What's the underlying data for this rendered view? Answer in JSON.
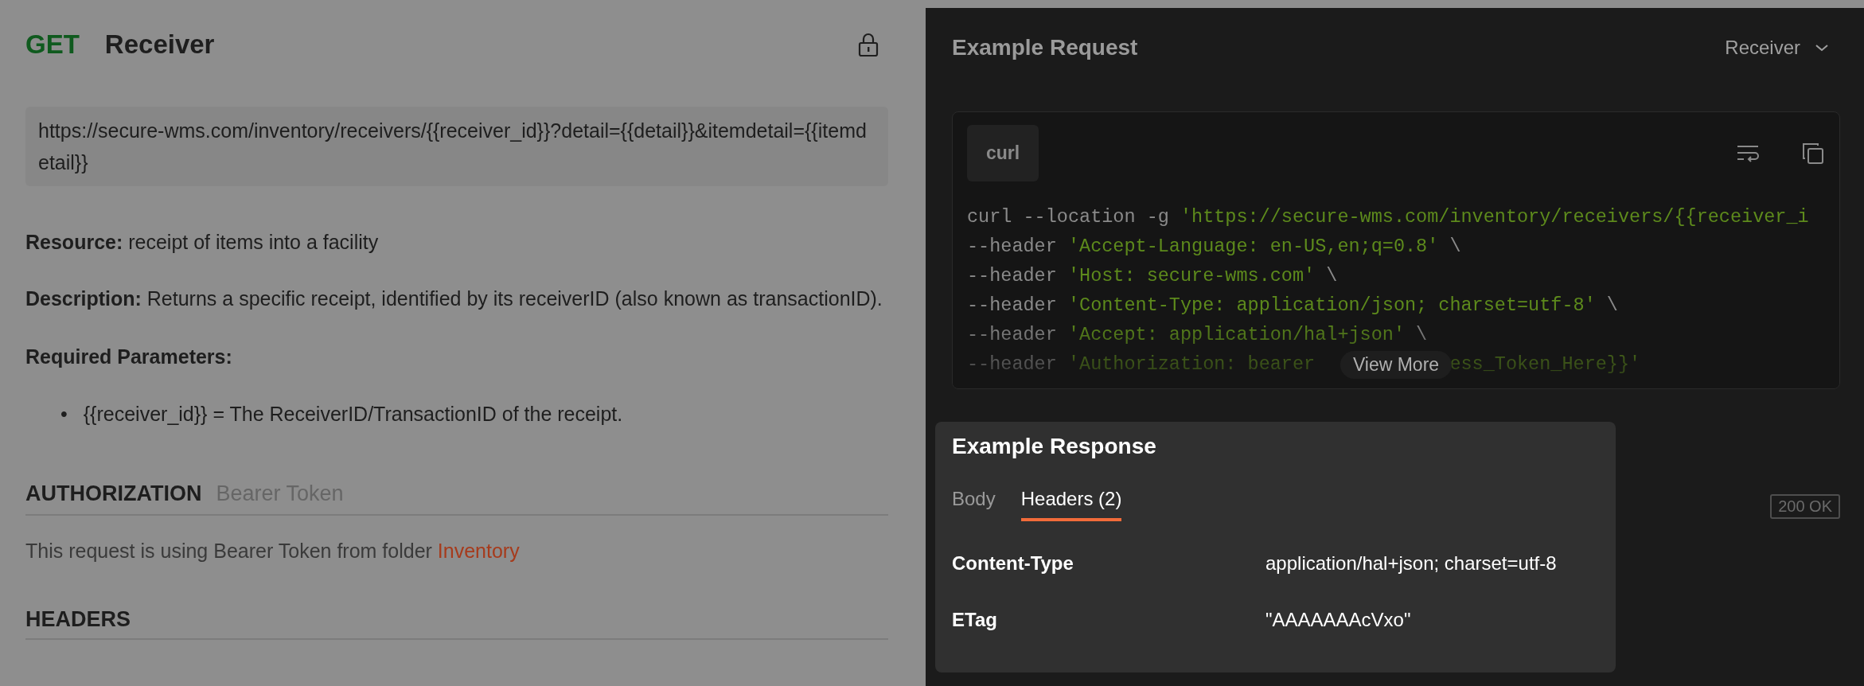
{
  "request": {
    "method": "GET",
    "name": "Receiver"
  },
  "url": "https://secure-wms.com/inventory/receivers/{{receiver_id}}?detail={{detail}}&itemdetail={{itemdetail}}",
  "paragraphs": [
    "**Resource:** receipt of items into a facility",
    "**Description:** Returns a specific receipt, identified by its receiverID (also known as transactionID)."
  ],
  "required_heading": "Required Parameters:",
  "parameters": [
    {
      "marker": "•",
      "text": "{{receiver_id}} = The ReceiverID/TransactionID of the receipt."
    }
  ],
  "authorization": {
    "heading": "AUTHORIZATION",
    "type": "Bearer Token",
    "note": "This request is using Bearer Token from folder",
    "folder_link": "Inventory"
  },
  "headers_section": {
    "heading": "HEADERS"
  },
  "example_request": {
    "title": "Example Request",
    "selector": "Receiver",
    "language_tab": "curl",
    "code_lines": [
      [
        {
          "kind": "plain",
          "text": "curl --location -g "
        },
        {
          "kind": "string",
          "text": "'https://secure-wms.com/inventory/receivers/{{receiver_i"
        }
      ],
      [
        {
          "kind": "plain",
          "text": "--header "
        },
        {
          "kind": "string",
          "text": "'Accept-Language: en-US,en;q=0.8'"
        },
        {
          "kind": "plain",
          "text": " \\"
        }
      ],
      [
        {
          "kind": "plain",
          "text": "--header "
        },
        {
          "kind": "string",
          "text": "'Host: secure-wms.com'"
        },
        {
          "kind": "plain",
          "text": " \\"
        }
      ],
      [
        {
          "kind": "plain",
          "text": "--header "
        },
        {
          "kind": "string",
          "text": "'Content-Type: application/json; charset=utf-8'"
        },
        {
          "kind": "plain",
          "text": " \\"
        }
      ],
      [
        {
          "kind": "plain",
          "text": "--header "
        },
        {
          "kind": "string",
          "text": "'Accept: application/hal+json'"
        },
        {
          "kind": "plain",
          "text": " \\"
        }
      ],
      [
        {
          "kind": "plain",
          "text": "--header "
        },
        {
          "kind": "string",
          "text": "'Authorization: bearer"
        },
        {
          "kind": "gap"
        },
        {
          "kind": "string",
          "text": "ess_Token_Here}}'"
        }
      ]
    ],
    "view_more": "View More"
  },
  "example_response": {
    "title": "Example Response",
    "tabs": [
      {
        "label": "Body",
        "selected": false
      },
      {
        "label": "Headers (2)",
        "selected": true
      }
    ],
    "headers": [
      {
        "name": "Content-Type",
        "value": "application/hal+json; charset=utf-8"
      },
      {
        "name": "ETag",
        "value": "\"AAAAAAAcVxo\""
      }
    ],
    "status": "200 OK"
  }
}
